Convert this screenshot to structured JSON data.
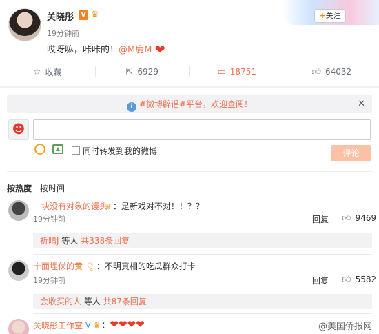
{
  "post": {
    "author": "关晓彤",
    "time": "19分钟前",
    "text_prefix": "哎呀嘛，咔咔的！",
    "mention": "@M鹿M",
    "follow_label": "关注",
    "actions": [
      {
        "label": "收藏",
        "icon": "star-icon"
      },
      {
        "label": "6929",
        "icon": "repost-icon"
      },
      {
        "label": "18751",
        "icon": "comment-icon"
      },
      {
        "label": "64032",
        "icon": "thumbs-up-icon"
      }
    ]
  },
  "notice": {
    "text": "#微博辟谣#平台，欢迎查阅！"
  },
  "composer": {
    "repost_label": "同时转发到我的微博",
    "submit_label": "评论"
  },
  "sort": {
    "hot": "按热度",
    "time": "按时间"
  },
  "comments": [
    {
      "user": "一块没有对象的馒头",
      "text": "：是新戏对不对！！？？",
      "time": "19分钟前",
      "reply": "回复",
      "likes": "9469",
      "sub_who": "祈晴J",
      "sub_mid": " 等人 ",
      "sub_more": "共338条回复"
    },
    {
      "user": "十面埋伏的黄",
      "text": "：不明真相的吃瓜群众打卡",
      "time": "19分钟前",
      "reply": "回复",
      "likes": "5582",
      "sub_who": "会收买的人",
      "sub_mid": " 等人 ",
      "sub_more": "共87条回复"
    },
    {
      "user": "关晓彤工作室",
      "text": "：",
      "hearts": "❤❤❤❤"
    }
  ],
  "watermark": "美国侨报网"
}
